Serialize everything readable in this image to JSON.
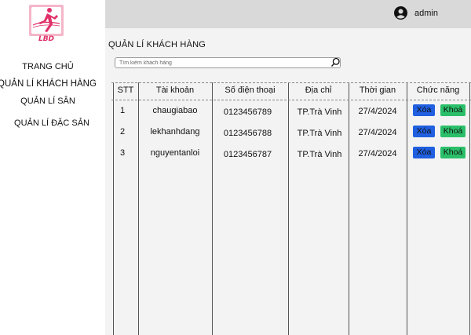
{
  "sidebar": {
    "logo_icon": "runner-logo-icon",
    "items": [
      {
        "label": "TRANG CHỦ"
      },
      {
        "label": "QUẢN LÍ KHÁCH HÀNG"
      },
      {
        "label": "QUẢN LÍ SÂN"
      },
      {
        "label": "QUẢN LÍ ĐẶC SẢN"
      }
    ]
  },
  "header": {
    "user_icon": "user-avatar-icon",
    "username": "admin"
  },
  "main": {
    "title": "QUẢN LÍ KHÁCH HÀNG",
    "search": {
      "placeholder": "Tìm kiếm khách hàng",
      "value": ""
    },
    "table": {
      "columns": [
        "STT",
        "Tài khoản",
        "Số điện thoại",
        "Địa chỉ",
        "Thời gian",
        "Chức năng"
      ],
      "rows": [
        {
          "stt": "1",
          "account": "chaugiabao",
          "phone": "0123456789",
          "address": "TP.Trà Vinh",
          "time": "27/4/2024",
          "delete": "Xóa",
          "lock": "Khoá"
        },
        {
          "stt": "2",
          "account": "lekhanhdang",
          "phone": "0123456788",
          "address": "TP.Trà Vinh",
          "time": "27/4/2024",
          "delete": "Xóa",
          "lock": "Khoá"
        },
        {
          "stt": "3",
          "account": "nguyentanloi",
          "phone": "0123456787",
          "address": "TP.Trà Vinh",
          "time": "27/4/2024",
          "delete": "Xóa",
          "lock": "Khoá"
        }
      ]
    }
  },
  "colors": {
    "topbar": "#d9d9d9",
    "content_bg": "#f3f3f3",
    "delete_button": "#1f5fe0",
    "lock_button": "#2bbf6a",
    "logo": "#e0306a"
  }
}
